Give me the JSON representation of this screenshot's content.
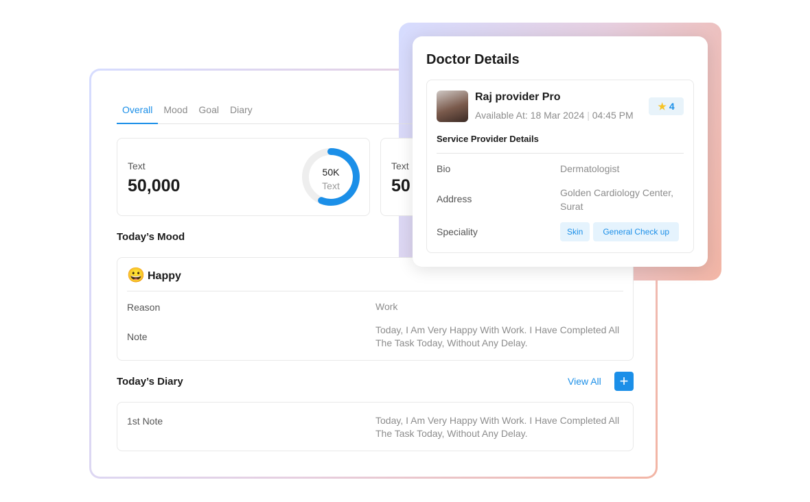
{
  "tabs": [
    "Overall",
    "Mood",
    "Goal",
    "Diary"
  ],
  "active_tab": "Overall",
  "stats": [
    {
      "label": "Text",
      "value": "50,000",
      "ring_value": "50K",
      "ring_label": "Text",
      "progress": 0.56
    },
    {
      "label": "Text",
      "value": "50"
    }
  ],
  "mood": {
    "title": "Today’s Mood",
    "emoji": "😀",
    "name": "Happy",
    "reason_label": "Reason",
    "reason": "Work",
    "note_label": "Note",
    "note": "Today, I Am Very Happy With Work. I Have Completed All The Task Today, Without Any Delay."
  },
  "diary": {
    "title": "Today’s Diary",
    "view_all": "View All",
    "add": "+",
    "entry_label": "1st Note",
    "entry": "Today, I Am Very Happy With Work. I Have Completed All The Task Today, Without Any Delay."
  },
  "doctor": {
    "title": "Doctor Details",
    "name": "Raj provider Pro",
    "available": "Available At: 18 Mar 2024",
    "time": "04:45 PM",
    "rating": "4",
    "section": "Service Provider Details",
    "bio_label": "Bio",
    "bio": "Dermatologist",
    "address_label": "Address",
    "address": "Golden Cardiology Center, Surat",
    "speciality_label": "Speciality",
    "specialities": [
      "Skin",
      "General Check up"
    ]
  },
  "colors": {
    "accent": "#1b8fe8",
    "star": "#f7c325"
  }
}
